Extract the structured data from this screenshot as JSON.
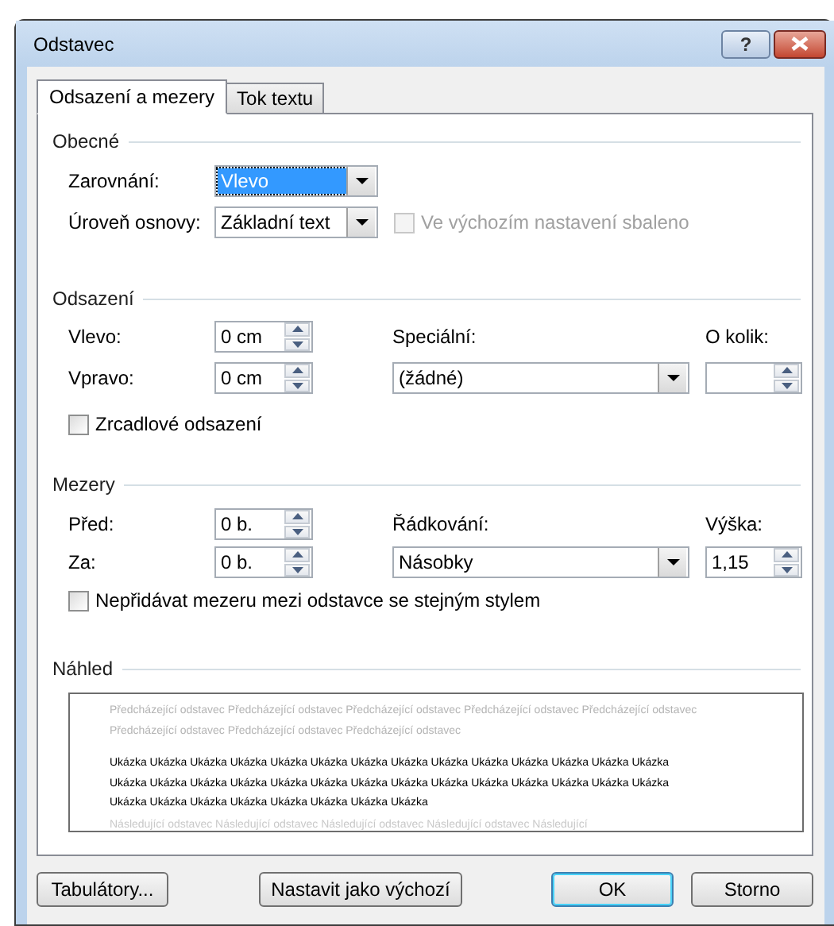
{
  "window": {
    "title": "Odstavec",
    "help_label": "?"
  },
  "tabs": [
    {
      "label": "Odsazení a mezery",
      "selected": true
    },
    {
      "label": "Tok textu",
      "selected": false
    }
  ],
  "general": {
    "title": "Obecné",
    "alignment": {
      "label": "Zarovnání:",
      "value": "Vlevo",
      "focused": true
    },
    "outline_level": {
      "label": "Úroveň osnovy:",
      "value": "Základní text",
      "focused": false
    },
    "collapsed": {
      "label": "Ve výchozím nastavení sbaleno",
      "checked": false,
      "disabled": true
    }
  },
  "indentation": {
    "title": "Odsazení",
    "left": {
      "label": "Vlevo:",
      "value": "0 cm"
    },
    "right": {
      "label": "Vpravo:",
      "value": "0 cm"
    },
    "special": {
      "label": "Speciální:",
      "value": "(žádné)",
      "focused": false
    },
    "by": {
      "label": "O kolik:"
    },
    "mirror": {
      "label": "Zrcadlové odsazení",
      "checked": false,
      "disabled": false
    }
  },
  "spacing": {
    "title": "Mezery",
    "before": {
      "label": "Před:",
      "value": "0 b."
    },
    "after": {
      "label": "Za:",
      "value": "0 b."
    },
    "line_spacing": {
      "label": "Řádkování:",
      "value": "Násobky",
      "focused": false
    },
    "at": {
      "label": "Výška:",
      "value": "1,15"
    },
    "no_space": {
      "label": "Nepřidávat mezeru mezi odstavce se stejným stylem",
      "checked": false,
      "disabled": false
    }
  },
  "preview": {
    "title": "Náhled",
    "paragraphs": [
      {
        "kind": "previous",
        "lines": [
          "Předcházející odstavec Předcházející odstavec Předcházející odstavec Předcházející odstavec Předcházející odstavec",
          "Předcházející odstavec Předcházející odstavec Předcházející odstavec"
        ]
      },
      {
        "kind": "sample",
        "lines": [
          "Ukázka Ukázka Ukázka Ukázka Ukázka Ukázka Ukázka Ukázka Ukázka Ukázka Ukázka Ukázka Ukázka Ukázka",
          "Ukázka Ukázka Ukázka Ukázka Ukázka Ukázka Ukázka Ukázka Ukázka Ukázka Ukázka Ukázka Ukázka Ukázka",
          "Ukázka Ukázka Ukázka Ukázka Ukázka Ukázka Ukázka Ukázka"
        ]
      },
      {
        "kind": "next",
        "lines": [
          "Následující odstavec Následující odstavec Následující odstavec Následující odstavec Následující"
        ]
      }
    ]
  },
  "buttons": [
    {
      "label": "Tabulátory...",
      "default": false
    },
    {
      "label": "Nastavit jako výchozí",
      "default": false
    },
    {
      "label": "OK",
      "default": true
    },
    {
      "label": "Storno",
      "default": false
    }
  ]
}
